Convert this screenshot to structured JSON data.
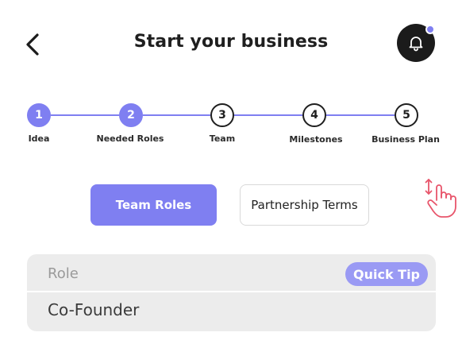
{
  "header": {
    "title": "Start your business",
    "back_icon": "chevron-left-icon",
    "bell_icon": "bell-icon"
  },
  "stepper": {
    "steps": [
      {
        "number": "1",
        "label": "Idea",
        "state": "done"
      },
      {
        "number": "2",
        "label": "Needed Roles",
        "state": "done"
      },
      {
        "number": "3",
        "label": "Team",
        "state": "todo"
      },
      {
        "number": "4",
        "label": "Milestones",
        "state": "todo"
      },
      {
        "number": "5",
        "label": "Business Plan",
        "state": "todo"
      }
    ]
  },
  "tabs": {
    "active_label": "Team Roles",
    "inactive_label": "Partnership Terms"
  },
  "role_card": {
    "label": "Role",
    "quick_tip": "Quick Tip",
    "value": "Co-Founder"
  },
  "colors": {
    "accent": "#7f7ff1",
    "quick_tip_bg": "#9a9af4",
    "hand_icon": "#e8556b",
    "card_bg": "#ececec"
  }
}
